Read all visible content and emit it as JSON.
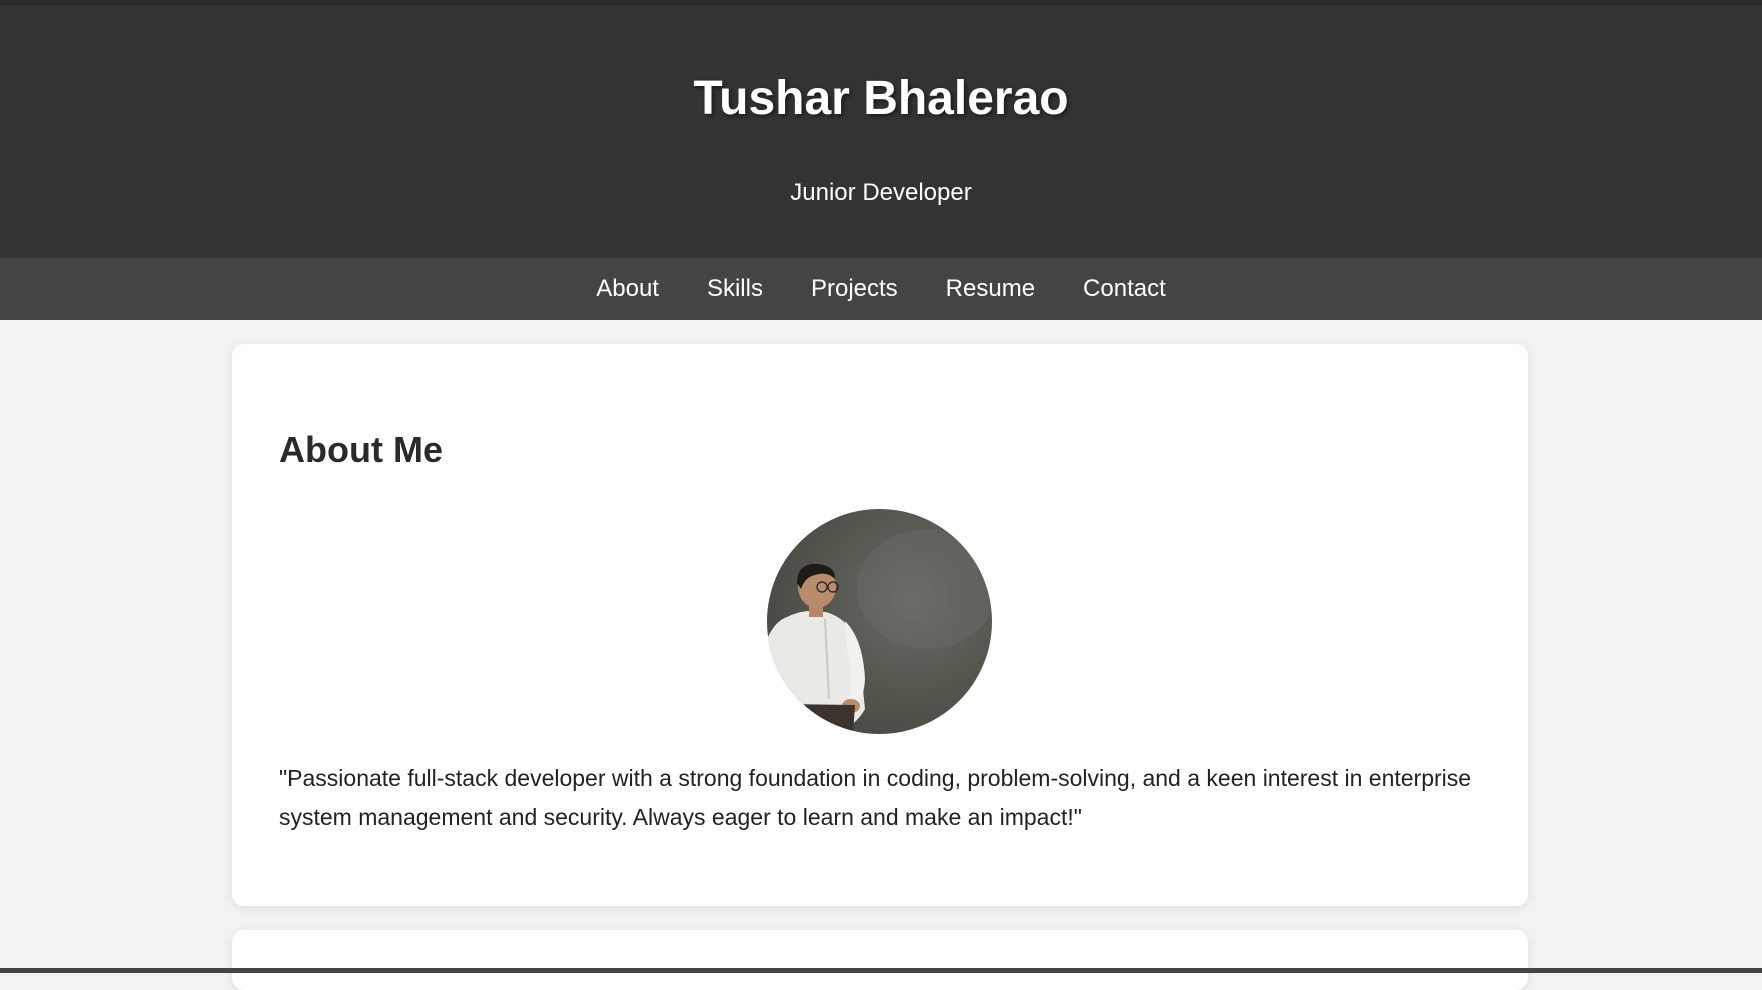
{
  "header": {
    "title": "Tushar Bhalerao",
    "subtitle": "Junior Developer"
  },
  "nav": {
    "items": [
      {
        "label": "About"
      },
      {
        "label": "Skills"
      },
      {
        "label": "Projects"
      },
      {
        "label": "Resume"
      },
      {
        "label": "Contact"
      }
    ]
  },
  "about": {
    "heading": "About Me",
    "text": "\"Passionate full-stack developer with a strong foundation in coding, problem-solving, and a keen interest in enterprise system management and security. Always eager to learn and make an impact!\""
  },
  "colors": {
    "header_bg": "#333333",
    "nav_bg": "#444444",
    "page_bg": "#f2f2f2",
    "card_bg": "#ffffff"
  }
}
